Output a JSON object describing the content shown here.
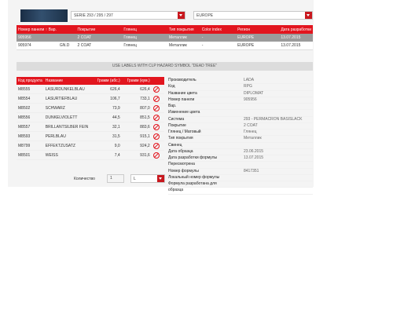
{
  "header": {
    "series_select": "SERIE 293 / 295 / 297",
    "region_select": "EUROPE"
  },
  "top_table": {
    "headers": [
      "Номер панели ↑ Вар.",
      "Покрытие",
      "Глянец",
      "Тип покрытия",
      "Color index",
      "Регион",
      "Дата разработки"
    ],
    "rows": [
      {
        "panel": "905956",
        "var": "",
        "coating": "2 COAT",
        "gloss": "Глянец",
        "type": "Металлик",
        "color_index": "-",
        "region": "EUROPE",
        "date": "13.07.2015",
        "selected": true
      },
      {
        "panel": "905974",
        "var": "GN.D",
        "coating": "2 COAT",
        "gloss": "Глянец",
        "type": "Металлик",
        "color_index": "-",
        "region": "EUROPE",
        "date": "13.07.2015",
        "selected": false
      }
    ]
  },
  "notice": "USE LABELS WITH CLP HAZARD SYMBOL \"DEAD TREE\"",
  "ingredients": {
    "headers": {
      "code": "Код продукта",
      "name": "Название",
      "grams_abs": "Грамм (абс.)",
      "grams_cum": "Грамм (кум.)"
    },
    "rows": [
      {
        "code": "M8555",
        "name": "LASURDUNKELBLAU",
        "abs": "626,4",
        "cum": "626,4"
      },
      {
        "code": "M8554",
        "name": "LASURTIEFBLAU",
        "abs": "106,7",
        "cum": "733,1"
      },
      {
        "code": "M8502",
        "name": "SCHWARZ",
        "abs": "73,9",
        "cum": "807,0"
      },
      {
        "code": "M8556",
        "name": "DUNKELVIOLETT",
        "abs": "44,5",
        "cum": "851,5"
      },
      {
        "code": "M8557",
        "name": "BRILLANTSILBER FEIN",
        "abs": "32,1",
        "cum": "883,6"
      },
      {
        "code": "M8593",
        "name": "PERLBLAU",
        "abs": "31,5",
        "cum": "915,1"
      },
      {
        "code": "M8799",
        "name": "EFFEKTZUSATZ",
        "abs": "9,0",
        "cum": "924,2"
      },
      {
        "code": "M8501",
        "name": "WEISS",
        "abs": "7,4",
        "cum": "931,6"
      }
    ]
  },
  "quantity": {
    "label": "Количество",
    "value": "1",
    "unit": "L"
  },
  "properties": [
    {
      "k": "Производитель",
      "v": "LADA"
    },
    {
      "k": "Код",
      "v": "RPG"
    },
    {
      "k": "Название цвета",
      "v": "DIPLOMAT"
    },
    {
      "k": "Номер панели",
      "v": "905956"
    },
    {
      "k": "Вар.",
      "v": ""
    },
    {
      "k": "Изменение цвета",
      "v": ""
    },
    {
      "k": "Система",
      "v": "293 - PERMACRON BASISLACK"
    },
    {
      "k": "Покрытие",
      "v": "2 COAT"
    },
    {
      "k": "Глянец / Матовый",
      "v": "Глянец"
    },
    {
      "k": "Тип покрытия",
      "v": "Металлик"
    },
    {
      "k": "Свинец",
      "v": ""
    },
    {
      "k": "Дата образца",
      "v": "23.06.2015"
    },
    {
      "k": "Дата разработки формулы",
      "v": "13.07.2015"
    },
    {
      "k": "Пересмотрена",
      "v": ""
    },
    {
      "k": "Номер формулы",
      "v": "8417351"
    },
    {
      "k": "Локальный номер формулы",
      "v": ""
    },
    {
      "k": "Формула разработана для",
      "v": ""
    },
    {
      "k": "образца",
      "v": ""
    }
  ],
  "colors": {
    "accent": "#e2151e",
    "selected_row": "#9b9b9b",
    "notice_bg": "#dcdcdc"
  }
}
